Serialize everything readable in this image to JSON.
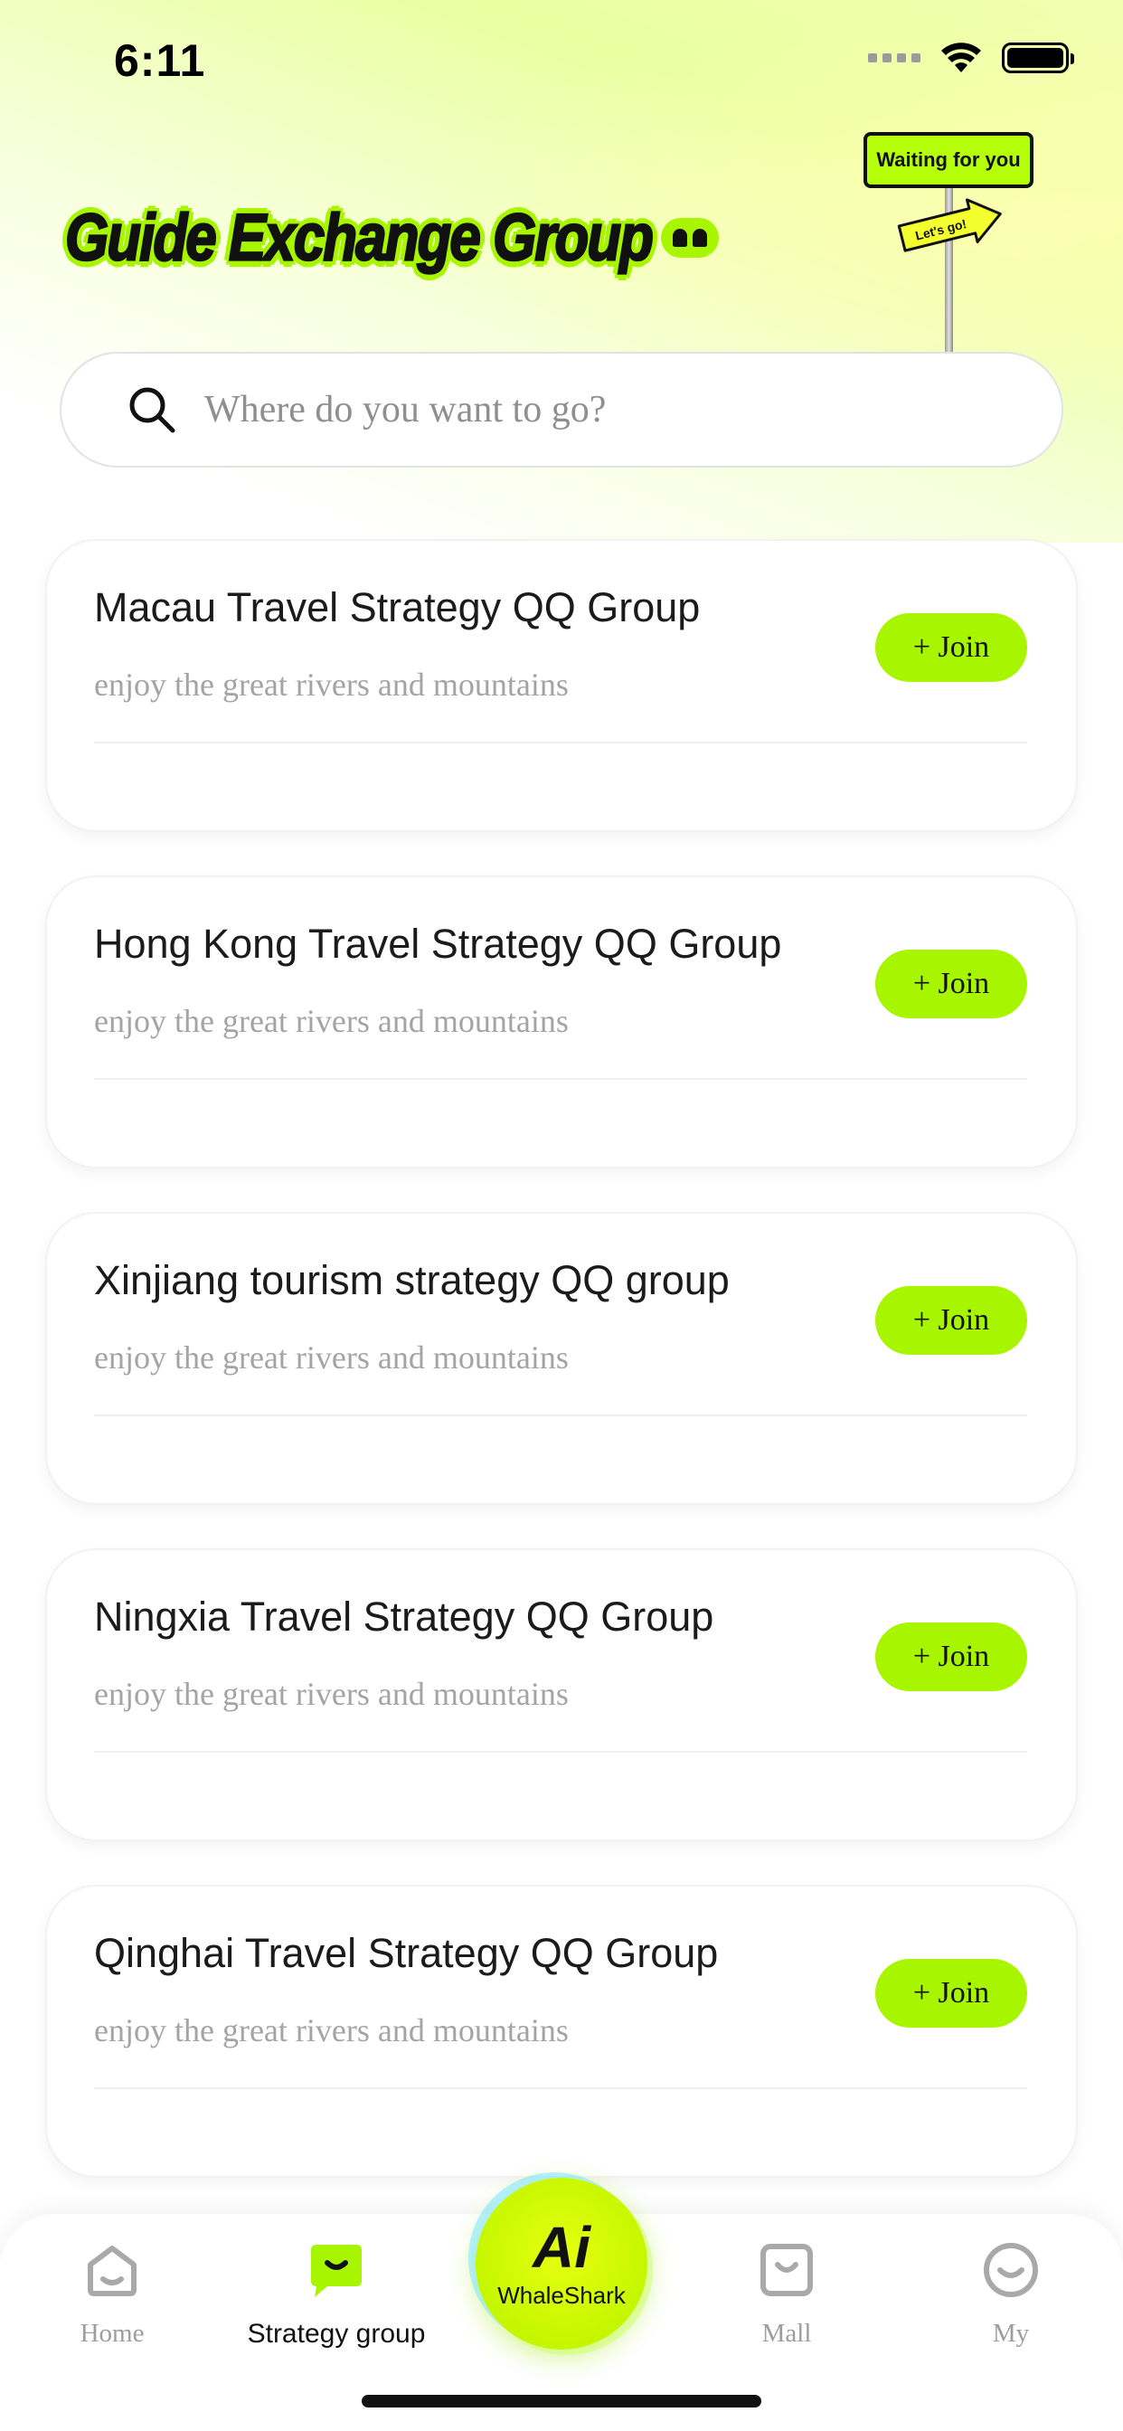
{
  "status_bar": {
    "time": "6:11"
  },
  "header": {
    "title": "Guide Exchange Group",
    "sign_top": "Waiting for you",
    "sign_arrow": "Let's go!"
  },
  "search": {
    "placeholder": "Where do you want to go?"
  },
  "groups": [
    {
      "title": "Macau Travel Strategy QQ Group",
      "subtitle": "enjoy the great rivers and mountains",
      "button": "+ Join"
    },
    {
      "title": "Hong Kong Travel Strategy QQ Group",
      "subtitle": "enjoy the great rivers and mountains",
      "button": "+ Join"
    },
    {
      "title": "Xinjiang tourism strategy QQ group",
      "subtitle": "enjoy the great rivers and mountains",
      "button": "+ Join"
    },
    {
      "title": "Ningxia Travel Strategy QQ Group",
      "subtitle": "enjoy the great rivers and mountains",
      "button": "+ Join"
    },
    {
      "title": "Qinghai Travel Strategy QQ Group",
      "subtitle": "enjoy the great rivers and mountains",
      "button": "+ Join"
    }
  ],
  "tabbar": {
    "home": "Home",
    "strategy": "Strategy group",
    "ai_glyph": "Ai",
    "ai_label": "WhaleShark",
    "mall": "Mall",
    "my": "My",
    "active": "strategy"
  },
  "colors": {
    "accent": "#a8f500",
    "text_primary": "#1b1b1b",
    "text_muted": "#a4a4a4"
  }
}
